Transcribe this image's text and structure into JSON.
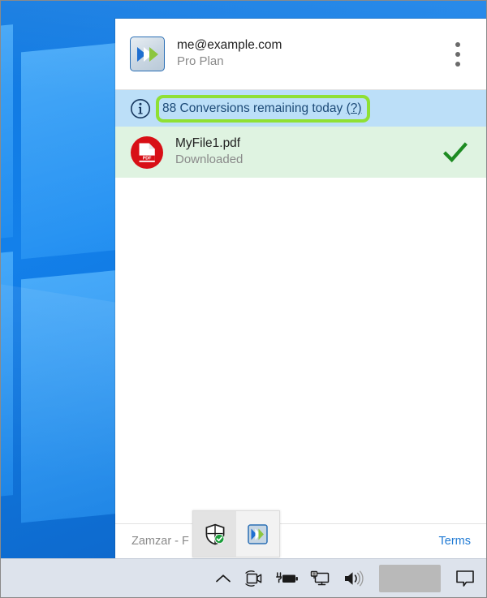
{
  "desktop": {
    "wallpaper_name": "windows-default-wallpaper",
    "wallpaper_color": "#0f6fd4"
  },
  "app": {
    "logo_icon": "zamzar-double-chevron-icon",
    "account": {
      "email": "me@example.com",
      "plan": "Pro Plan"
    },
    "menu_icon": "kebab-menu-icon",
    "info_bar": {
      "icon": "info-circle-icon",
      "text": "88 Conversions remaining today",
      "help_label": "(?)",
      "count": 88,
      "highlight_color": "#8fe034",
      "background_color": "#bcdff8",
      "text_color": "#1c4a77"
    },
    "files": [
      {
        "icon": "pdf-file-icon",
        "name": "MyFile1.pdf",
        "status": "Downloaded",
        "status_icon": "green-checkmark-icon",
        "row_color": "#dff3e1",
        "check_color": "#1d8b22"
      }
    ],
    "footer": {
      "brand": "Zamzar - F",
      "terms_label": "Terms",
      "terms_color": "#1f7ad4"
    }
  },
  "tray_flyout": {
    "items": [
      {
        "icon": "windows-security-shield-icon",
        "label": "Windows Security"
      },
      {
        "icon": "zamzar-double-chevron-icon",
        "label": "Zamzar"
      }
    ]
  },
  "taskbar": {
    "background_color": "#dde3ec",
    "items": [
      {
        "icon": "chevron-up-icon",
        "label": "Show hidden icons"
      },
      {
        "icon": "camera-icon",
        "label": "Camera"
      },
      {
        "icon": "battery-charging-icon",
        "label": "Battery"
      },
      {
        "icon": "network-monitor-icon",
        "label": "Network"
      },
      {
        "icon": "speaker-volume-icon",
        "label": "Volume"
      }
    ],
    "clock": {
      "icon": "clock-blurred-block",
      "label": ""
    },
    "action_center": {
      "icon": "notification-bubble-icon",
      "label": "Action Center"
    }
  }
}
